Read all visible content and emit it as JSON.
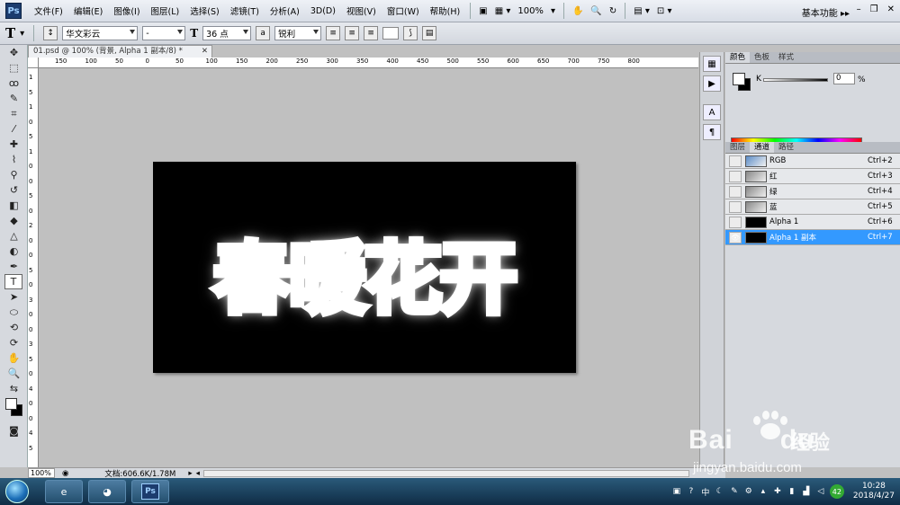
{
  "app": {
    "logo": "Ps"
  },
  "menu": [
    "文件(F)",
    "编辑(E)",
    "图像(I)",
    "图层(L)",
    "选择(S)",
    "滤镜(T)",
    "分析(A)",
    "3D(D)",
    "视图(V)",
    "窗口(W)",
    "帮助(H)"
  ],
  "menubar_zoom": "100%",
  "workspace": "基本功能",
  "options": {
    "tool_glyph": "T",
    "font_family": "华文彩云",
    "font_style": "-",
    "font_size": "36 点",
    "aa_label": "a",
    "antialias": "锐利"
  },
  "document": {
    "tab_title": "01.psd @ 100% (背景, Alpha 1 副本/8) *",
    "close": "✕",
    "canvas_text": "春暖花开"
  },
  "ruler_h": [
    "150",
    "100",
    "50",
    "0",
    "50",
    "100",
    "150",
    "200",
    "250",
    "300",
    "350",
    "400",
    "450",
    "500",
    "550",
    "600",
    "650",
    "700",
    "750",
    "800"
  ],
  "ruler_v": [
    "1",
    "5",
    "1",
    "0",
    "5",
    "1",
    "0",
    "0",
    "5",
    "0",
    "2",
    "0",
    "0",
    "5",
    "0",
    "3",
    "0",
    "0",
    "3",
    "5",
    "0",
    "4",
    "0",
    "0",
    "4",
    "5"
  ],
  "status": {
    "zoom": "100%",
    "doc": "文档:606.6K/1.78M"
  },
  "color_panel": {
    "tabs": [
      "颜色",
      "色板",
      "样式"
    ],
    "k_label": "K",
    "k_value": "0",
    "k_unit": "%"
  },
  "channels_panel": {
    "tabs": [
      "图层",
      "通道",
      "路径"
    ],
    "rows": [
      {
        "name": "RGB",
        "key": "Ctrl+2"
      },
      {
        "name": "红",
        "key": "Ctrl+3"
      },
      {
        "name": "绿",
        "key": "Ctrl+4"
      },
      {
        "name": "蓝",
        "key": "Ctrl+5"
      },
      {
        "name": "Alpha 1",
        "key": "Ctrl+6"
      },
      {
        "name": "Alpha 1 副本",
        "key": "Ctrl+7"
      }
    ]
  },
  "taskbar": {
    "ps": "Ps",
    "tray_lang": "中",
    "badge": "42",
    "time": "10:28",
    "date": "2018/4/27"
  },
  "watermark": {
    "brand": "Bai",
    "brand2": "du",
    "cn": "经验",
    "url": "jingyan.baidu.com"
  }
}
